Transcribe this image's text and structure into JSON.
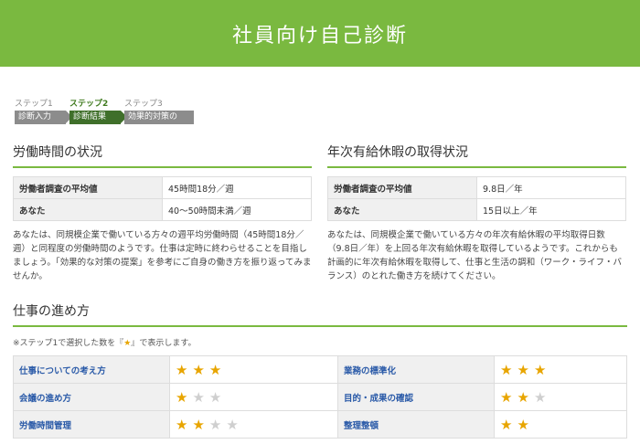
{
  "header": {
    "title": "社員向け自己診断"
  },
  "steps": [
    {
      "label": "ステップ1",
      "name": "診断入力"
    },
    {
      "label": "ステップ2",
      "name": "診断結果"
    },
    {
      "label": "ステップ3",
      "name": "効果的対策の提案"
    }
  ],
  "working_hours": {
    "title": "労働時間の状況",
    "rows": [
      {
        "key": "労働者調査の平均値",
        "value": "45時間18分／週"
      },
      {
        "key": "あなた",
        "value": "40～50時間未満／週"
      }
    ],
    "note": "あなたは、同規模企業で働いている方々の週平均労働時間（45時間18分／週）と同程度の労働時間のようです。仕事は定時に終わらせることを目指しましょう。「効果的な対策の提案」を参考にご自身の働き方を振り返ってみませんか。"
  },
  "paid_leave": {
    "title": "年次有給休暇の取得状況",
    "rows": [
      {
        "key": "労働者調査の平均値",
        "value": "9.8日／年"
      },
      {
        "key": "あなた",
        "value": "15日以上／年"
      }
    ],
    "note": "あなたは、同規模企業で働いている方々の年次有給休暇の平均取得日数（9.8日／年）を上回る年次有給休暇を取得しているようです。これからも計画的に年次有給休暇を取得して、仕事と生活の調和（ワーク・ライフ・バランス）のとれた働き方を続けてください。"
  },
  "work_style": {
    "title": "仕事の進め方",
    "note_prefix": "※ステップ1で選択した数を『",
    "note_star": "★",
    "note_suffix": "』で表示します。",
    "items": [
      {
        "label": "仕事についての考え方",
        "stars": 3,
        "max": 3
      },
      {
        "label": "業務の標準化",
        "stars": 3,
        "max": 3
      },
      {
        "label": "会議の進め方",
        "stars": 1,
        "max": 3
      },
      {
        "label": "目的・成果の確認",
        "stars": 2,
        "max": 3
      },
      {
        "label": "労働時間管理",
        "stars": 2,
        "max": 4
      },
      {
        "label": "整理整頓",
        "stars": 2,
        "max": 2
      }
    ]
  }
}
